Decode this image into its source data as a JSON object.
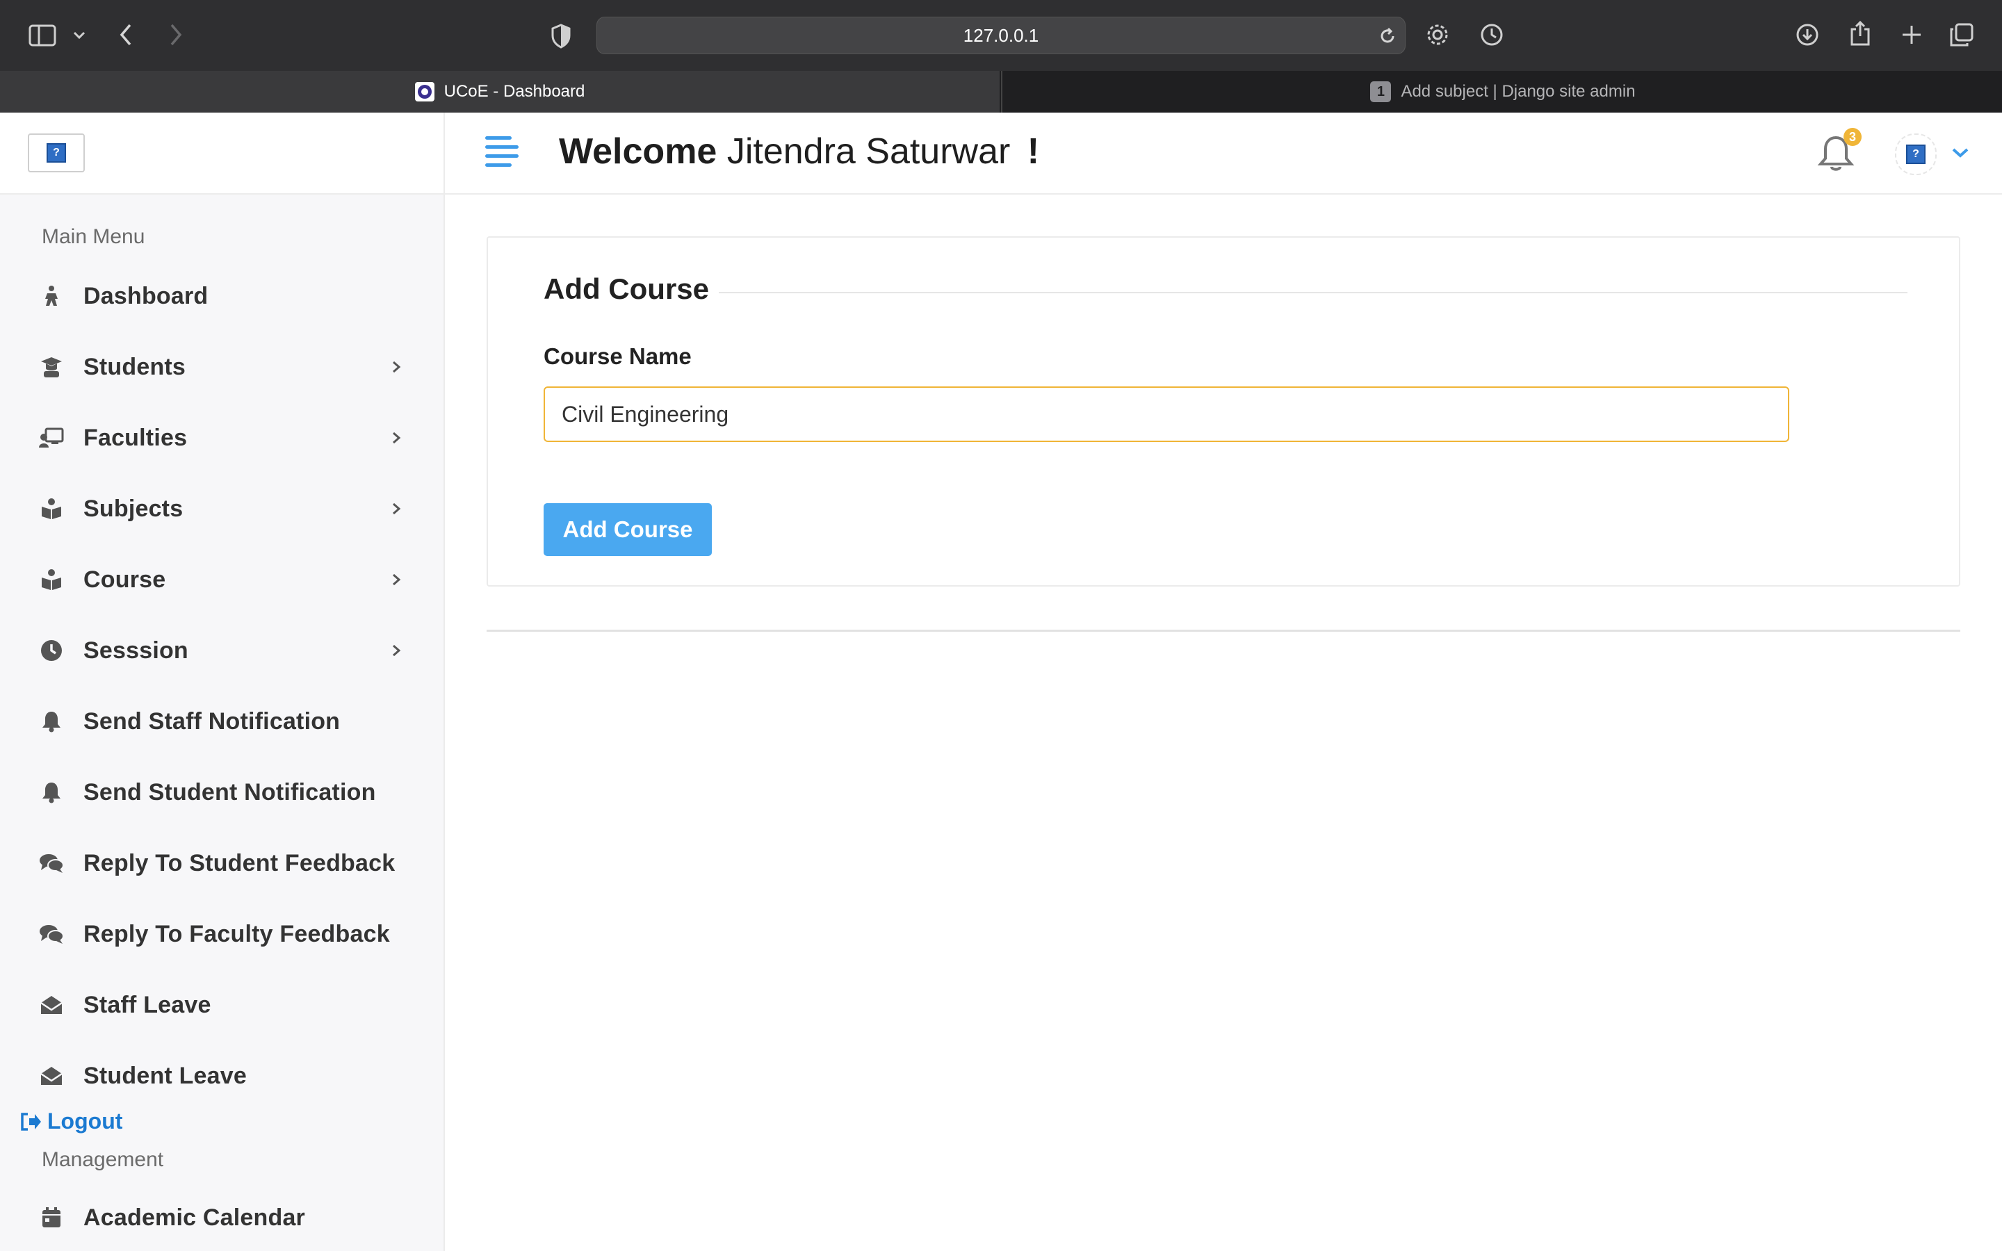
{
  "browser": {
    "url": "127.0.0.1",
    "tabs": [
      {
        "title": "UCoE - Dashboard",
        "active": true
      },
      {
        "title": "Add subject | Django site admin",
        "active": false,
        "badge": "1"
      }
    ]
  },
  "sidebar": {
    "logo_placeholder": "?",
    "section_main": "Main Menu",
    "items": [
      {
        "label": "Dashboard",
        "icon": "dashboard-icon",
        "has_submenu": false
      },
      {
        "label": "Students",
        "icon": "graduate-icon",
        "has_submenu": true
      },
      {
        "label": "Faculties",
        "icon": "teacher-icon",
        "has_submenu": true
      },
      {
        "label": "Subjects",
        "icon": "book-reader-icon",
        "has_submenu": true
      },
      {
        "label": "Course",
        "icon": "book-reader-icon",
        "has_submenu": true
      },
      {
        "label": "Sesssion",
        "icon": "clock-icon",
        "has_submenu": true
      },
      {
        "label": "Send Staff Notification",
        "icon": "bell-icon",
        "has_submenu": false
      },
      {
        "label": "Send Student Notification",
        "icon": "bell-icon",
        "has_submenu": false
      },
      {
        "label": "Reply To Student Feedback",
        "icon": "comments-icon",
        "has_submenu": false
      },
      {
        "label": "Reply To Faculty Feedback",
        "icon": "comments-icon",
        "has_submenu": false
      },
      {
        "label": "Staff Leave",
        "icon": "envelope-open-icon",
        "has_submenu": false
      },
      {
        "label": "Student Leave",
        "icon": "envelope-open-icon",
        "has_submenu": false
      }
    ],
    "logout_label": "Logout",
    "section_management": "Management",
    "management_items": [
      {
        "label": "Academic Calendar",
        "icon": "calendar-icon"
      }
    ]
  },
  "header": {
    "welcome_bold": "Welcome",
    "user_name": "Jitendra Saturwar",
    "exclaim": "!",
    "notification_count": "3",
    "avatar_placeholder": "?"
  },
  "form": {
    "title": "Add Course",
    "field_label": "Course Name",
    "field_value": "Civil Engineering",
    "submit_label": "Add Course"
  },
  "colors": {
    "accent_blue": "#4aa8f0",
    "focus_orange": "#f0b537",
    "link_blue": "#1b7ad1"
  }
}
